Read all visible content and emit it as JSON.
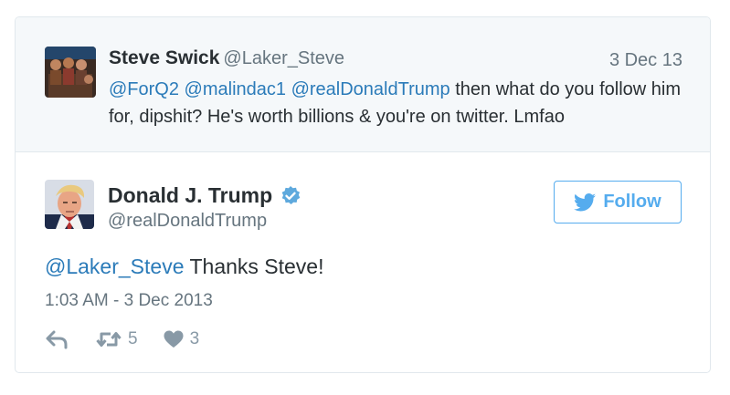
{
  "parent_tweet": {
    "author_name": "Steve Swick",
    "author_handle": "@Laker_Steve",
    "date": "3 Dec 13",
    "mentions": [
      "@ForQ2",
      "@malindac1",
      "@realDonaldTrump"
    ],
    "text_rest": " then what do you follow him for, dipshit? He's worth billions & you're on twitter. Lmfao"
  },
  "main_tweet": {
    "author_name": "Donald J. Trump",
    "author_handle": "@realDonaldTrump",
    "verified": true,
    "follow_label": "Follow",
    "mention": "@Laker_Steve",
    "text_rest": " Thanks Steve!",
    "timestamp": "1:03 AM - 3 Dec 2013",
    "retweet_count": "5",
    "like_count": "3"
  },
  "icons": {
    "reply": "reply-icon",
    "retweet": "retweet-icon",
    "like": "heart-icon",
    "verified": "verified-badge-icon",
    "follow": "twitter-bird-icon"
  },
  "colors": {
    "link": "#2b7bb9",
    "follow_blue": "#55acee",
    "secondary_text": "#66757f",
    "action_gray": "#8899a6",
    "parent_bg": "#f5f8fa",
    "border": "#e1e8ed"
  }
}
